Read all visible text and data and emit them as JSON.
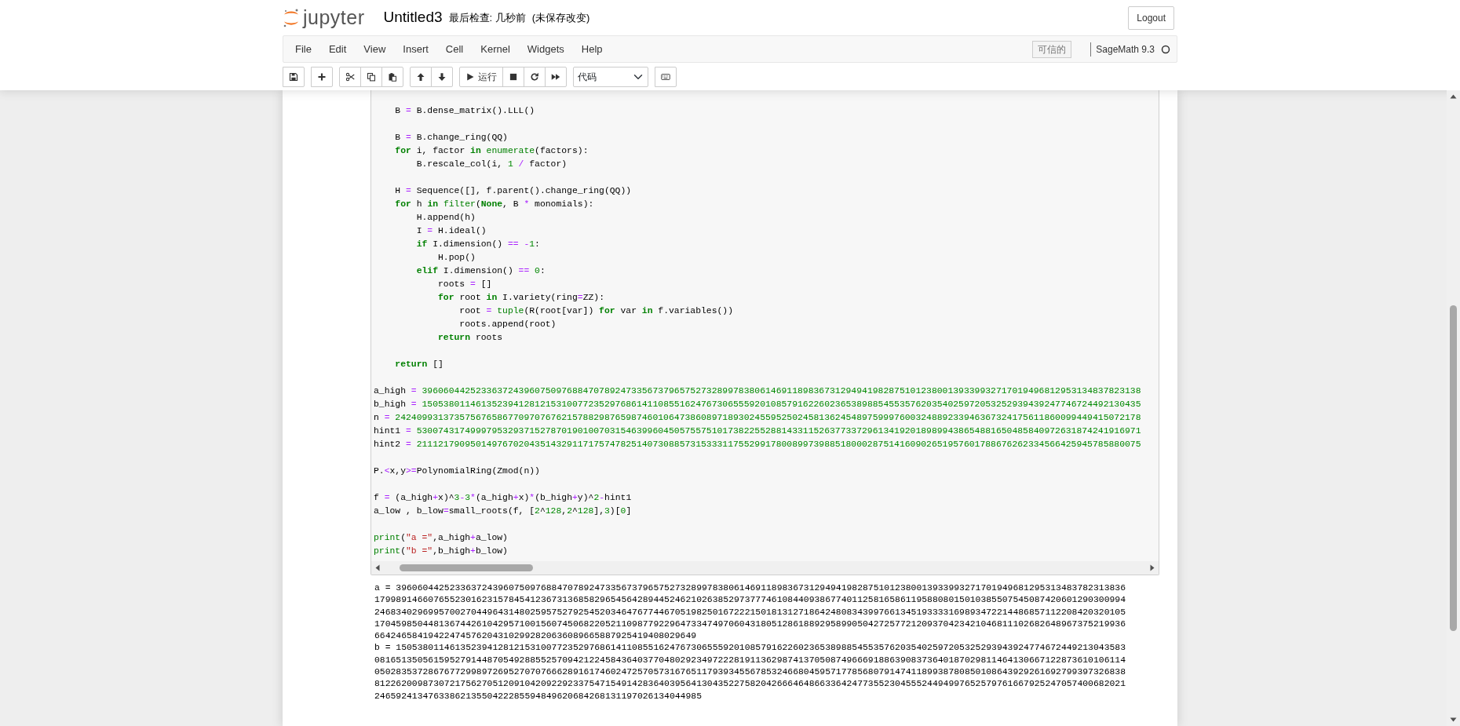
{
  "header": {
    "logo_text": "jupyter",
    "notebook_name": "Untitled3",
    "checkpoint": "最后检查: 几秒前",
    "autosave_status": "(未保存改变)",
    "logout_button": "Logout"
  },
  "menu_bar": {
    "items": [
      "File",
      "Edit",
      "View",
      "Insert",
      "Cell",
      "Kernel",
      "Widgets",
      "Help"
    ],
    "trusted_badge": "可信的",
    "kernel_name": "SageMath 9.3",
    "kernel_busy": false
  },
  "toolbar": [
    [
      {
        "kind": "save"
      }
    ],
    [
      {
        "kind": "insert"
      }
    ],
    [
      {
        "kind": "cut"
      },
      {
        "kind": "copy"
      },
      {
        "kind": "paste"
      }
    ],
    [
      {
        "kind": "move_up"
      },
      {
        "kind": "move_down"
      }
    ],
    [
      {
        "kind": "run",
        "label": "运行"
      },
      {
        "kind": "interrupt"
      },
      {
        "kind": "restart"
      },
      {
        "kind": "run_all"
      }
    ],
    [
      {
        "kind": "select",
        "value": "代码"
      }
    ],
    [
      {
        "kind": "keyboard"
      }
    ]
  ],
  "code_cell": {
    "lines": [
      {
        "kind": "code",
        "tokens": [
          {
            "kind": "plain",
            "text": "    B "
          },
          {
            "kind": "operator",
            "text": "= "
          },
          {
            "kind": "plain",
            "text": "B.dense_matrix().LLL()"
          }
        ]
      },
      {
        "kind": "blank"
      },
      {
        "kind": "code",
        "tokens": [
          {
            "kind": "plain",
            "text": "    B "
          },
          {
            "kind": "operator",
            "text": "= "
          },
          {
            "kind": "plain",
            "text": "B.change_ring(QQ)"
          }
        ]
      },
      {
        "kind": "code",
        "tokens": [
          {
            "kind": "keyword",
            "text": "    for"
          },
          {
            "kind": "plain",
            "text": " i, factor "
          },
          {
            "kind": "keyword",
            "text": "in "
          },
          {
            "kind": "builtin",
            "text": "enumerate"
          },
          {
            "kind": "plain",
            "text": "(factors):"
          }
        ]
      },
      {
        "kind": "code",
        "tokens": [
          {
            "kind": "plain",
            "text": "        B.rescale_col(i, "
          },
          {
            "kind": "number",
            "text": "1 "
          },
          {
            "kind": "operator",
            "text": "/"
          },
          {
            "kind": "plain",
            "text": " factor)"
          }
        ]
      },
      {
        "kind": "blank"
      },
      {
        "kind": "code",
        "tokens": [
          {
            "kind": "plain",
            "text": "    H "
          },
          {
            "kind": "operator",
            "text": "= "
          },
          {
            "kind": "plain",
            "text": "Sequence([], f.parent().change_ring(QQ))"
          }
        ]
      },
      {
        "kind": "code",
        "tokens": [
          {
            "kind": "keyword",
            "text": "    for"
          },
          {
            "kind": "plain",
            "text": " h "
          },
          {
            "kind": "keyword",
            "text": "in "
          },
          {
            "kind": "builtin",
            "text": "filter"
          },
          {
            "kind": "plain",
            "text": "("
          },
          {
            "kind": "keyword",
            "text": "None"
          },
          {
            "kind": "plain",
            "text": ", B "
          },
          {
            "kind": "operator",
            "text": "*"
          },
          {
            "kind": "plain",
            "text": " monomials):"
          }
        ]
      },
      {
        "kind": "code",
        "tokens": [
          {
            "kind": "plain",
            "text": "        H.append(h)"
          }
        ]
      },
      {
        "kind": "code",
        "tokens": [
          {
            "kind": "plain",
            "text": "        I "
          },
          {
            "kind": "operator",
            "text": "= "
          },
          {
            "kind": "plain",
            "text": "H.ideal()"
          }
        ]
      },
      {
        "kind": "code",
        "tokens": [
          {
            "kind": "keyword",
            "text": "        if"
          },
          {
            "kind": "plain",
            "text": " I.dimension() "
          },
          {
            "kind": "operator",
            "text": "== -"
          },
          {
            "kind": "number",
            "text": "1"
          },
          {
            "kind": "plain",
            "text": ":"
          }
        ]
      },
      {
        "kind": "code",
        "tokens": [
          {
            "kind": "plain",
            "text": "            H.pop()"
          }
        ]
      },
      {
        "kind": "code",
        "tokens": [
          {
            "kind": "keyword",
            "text": "        elif"
          },
          {
            "kind": "plain",
            "text": " I.dimension() "
          },
          {
            "kind": "operator",
            "text": "== "
          },
          {
            "kind": "number",
            "text": "0"
          },
          {
            "kind": "plain",
            "text": ":"
          }
        ]
      },
      {
        "kind": "code",
        "tokens": [
          {
            "kind": "plain",
            "text": "            roots "
          },
          {
            "kind": "operator",
            "text": "= "
          },
          {
            "kind": "plain",
            "text": "[]"
          }
        ]
      },
      {
        "kind": "code",
        "tokens": [
          {
            "kind": "keyword",
            "text": "            for"
          },
          {
            "kind": "plain",
            "text": " root "
          },
          {
            "kind": "keyword",
            "text": "in"
          },
          {
            "kind": "plain",
            "text": " I.variety(ring"
          },
          {
            "kind": "operator",
            "text": "="
          },
          {
            "kind": "plain",
            "text": "ZZ):"
          }
        ]
      },
      {
        "kind": "code",
        "tokens": [
          {
            "kind": "plain",
            "text": "                root "
          },
          {
            "kind": "operator",
            "text": "= "
          },
          {
            "kind": "builtin",
            "text": "tuple"
          },
          {
            "kind": "plain",
            "text": "(R(root[var]) "
          },
          {
            "kind": "keyword",
            "text": "for"
          },
          {
            "kind": "plain",
            "text": " var "
          },
          {
            "kind": "keyword",
            "text": "in"
          },
          {
            "kind": "plain",
            "text": " f.variables())"
          }
        ]
      },
      {
        "kind": "code",
        "tokens": [
          {
            "kind": "plain",
            "text": "                roots.append(root)"
          }
        ]
      },
      {
        "kind": "code",
        "tokens": [
          {
            "kind": "keyword",
            "text": "            return"
          },
          {
            "kind": "plain",
            "text": " roots"
          }
        ]
      },
      {
        "kind": "blank"
      },
      {
        "kind": "code",
        "tokens": [
          {
            "kind": "keyword",
            "text": "    return"
          },
          {
            "kind": "plain",
            "text": " []"
          }
        ]
      },
      {
        "kind": "blank"
      },
      {
        "kind": "code",
        "tokens": [
          {
            "kind": "plain",
            "text": "a_high "
          },
          {
            "kind": "operator",
            "text": "= "
          },
          {
            "kind": "number",
            "text": "39606044252336372439607509768847078924733567379657527328997838061469118983673129494198287510123800139339932717019496812953134837823138"
          }
        ]
      },
      {
        "kind": "code",
        "tokens": [
          {
            "kind": "plain",
            "text": "b_high "
          },
          {
            "kind": "operator",
            "text": "= "
          },
          {
            "kind": "number",
            "text": "15053801146135239412812153100772352976861411085516247673065559201085791622602365389885455357620354025972053252939439247746724492130435"
          }
        ]
      },
      {
        "kind": "code",
        "tokens": [
          {
            "kind": "plain",
            "text": "n "
          },
          {
            "kind": "operator",
            "text": "= "
          },
          {
            "kind": "number",
            "text": "2424099313735756765867709707676215788298765987460106473860897189302455952502458136245489759997600324889233946367324175611860099449415072178"
          }
        ]
      },
      {
        "kind": "code",
        "tokens": [
          {
            "kind": "plain",
            "text": "hint1 "
          },
          {
            "kind": "operator",
            "text": "= "
          },
          {
            "kind": "number",
            "text": "530074317499979532937152787019010070315463996045057557510173822552881433115263773372961341920189899438654881650485840972631874241916971"
          }
        ]
      },
      {
        "kind": "code",
        "tokens": [
          {
            "kind": "plain",
            "text": "hint2 "
          },
          {
            "kind": "operator",
            "text": "= "
          },
          {
            "kind": "number",
            "text": "211121790950149767020435143291171757478251407308857315333117552991780089973988518000287514160902651957601788676262334566425945785880075"
          }
        ]
      },
      {
        "kind": "blank"
      },
      {
        "kind": "code",
        "tokens": [
          {
            "kind": "plain",
            "text": "P."
          },
          {
            "kind": "operator",
            "text": "<"
          },
          {
            "kind": "plain",
            "text": "x,y"
          },
          {
            "kind": "operator",
            "text": ">="
          },
          {
            "kind": "plain",
            "text": "PolynomialRing(Zmod(n))"
          }
        ]
      },
      {
        "kind": "blank"
      },
      {
        "kind": "code",
        "tokens": [
          {
            "kind": "plain",
            "text": "f "
          },
          {
            "kind": "operator",
            "text": "= "
          },
          {
            "kind": "plain",
            "text": "(a_high"
          },
          {
            "kind": "operator",
            "text": "+"
          },
          {
            "kind": "plain",
            "text": "x)^"
          },
          {
            "kind": "number",
            "text": "3"
          },
          {
            "kind": "operator",
            "text": "-"
          },
          {
            "kind": "number",
            "text": "3"
          },
          {
            "kind": "operator",
            "text": "*"
          },
          {
            "kind": "plain",
            "text": "(a_high"
          },
          {
            "kind": "operator",
            "text": "+"
          },
          {
            "kind": "plain",
            "text": "x)"
          },
          {
            "kind": "operator",
            "text": "*"
          },
          {
            "kind": "plain",
            "text": "(b_high"
          },
          {
            "kind": "operator",
            "text": "+"
          },
          {
            "kind": "plain",
            "text": "y)^"
          },
          {
            "kind": "number",
            "text": "2"
          },
          {
            "kind": "operator",
            "text": "-"
          },
          {
            "kind": "plain",
            "text": "hint1"
          }
        ]
      },
      {
        "kind": "code",
        "tokens": [
          {
            "kind": "plain",
            "text": "a_low , b_low"
          },
          {
            "kind": "operator",
            "text": "="
          },
          {
            "kind": "plain",
            "text": "small_roots(f, ["
          },
          {
            "kind": "number",
            "text": "2"
          },
          {
            "kind": "plain",
            "text": "^"
          },
          {
            "kind": "number",
            "text": "128"
          },
          {
            "kind": "plain",
            "text": ","
          },
          {
            "kind": "number",
            "text": "2"
          },
          {
            "kind": "plain",
            "text": "^"
          },
          {
            "kind": "number",
            "text": "128"
          },
          {
            "kind": "plain",
            "text": "],"
          },
          {
            "kind": "number",
            "text": "3"
          },
          {
            "kind": "plain",
            "text": ")["
          },
          {
            "kind": "number",
            "text": "0"
          },
          {
            "kind": "plain",
            "text": "]"
          }
        ]
      },
      {
        "kind": "blank"
      },
      {
        "kind": "code",
        "tokens": [
          {
            "kind": "builtin",
            "text": "print"
          },
          {
            "kind": "plain",
            "text": "("
          },
          {
            "kind": "string",
            "text": "\"a =\""
          },
          {
            "kind": "plain",
            "text": ",a_high"
          },
          {
            "kind": "operator",
            "text": "+"
          },
          {
            "kind": "plain",
            "text": "a_low)"
          }
        ]
      },
      {
        "kind": "code",
        "tokens": [
          {
            "kind": "builtin",
            "text": "print"
          },
          {
            "kind": "plain",
            "text": "("
          },
          {
            "kind": "string",
            "text": "\"b =\""
          },
          {
            "kind": "plain",
            "text": ",b_high"
          },
          {
            "kind": "operator",
            "text": "+"
          },
          {
            "kind": "plain",
            "text": "b_low)"
          }
        ]
      }
    ]
  },
  "output": {
    "lines": [
      "a = 3960604425233637243960750976884707892473356737965752732899783806146911898367312949419828751012380013933993271701949681295313483782313836",
      "17998914660765523016231578454123673136858296545642894452462102638529737774610844093867740112581658611958808015010385507545087420601290300994",
      "24683402969957002704496431480259575279254520346476774467051982501672221501813127186424808343997661345193333169893472214486857112208420320105",
      "17045985044813674426104295710015607450682205211098779229647334749706043180512861889295899050427257721209370423421046811102682648967375219936",
      "664246584194224745762043102992820636089665887925419408029649",
      "b = 1505380114613523941281215310077235297686141108551624767306555920108579162260236538988545535762035402597205325293943924774672449213043583",
      "08165135056159527914487054928855257094212245843640377048029234972228191136298741370508749666918863908373640187029811464130667122873610106114",
      "05028353728676772998972695270707666289161746024725705731676511793934556785324668045957177856807914741189938780850108643929261692799397326838",
      "81226200987307217562705120910420922923375471549142836403956413043522758204266646486633642477355230455524494997652579761667925247057400682021",
      "2465924134763386213550422285594849620684268131197026134044985"
    ]
  }
}
